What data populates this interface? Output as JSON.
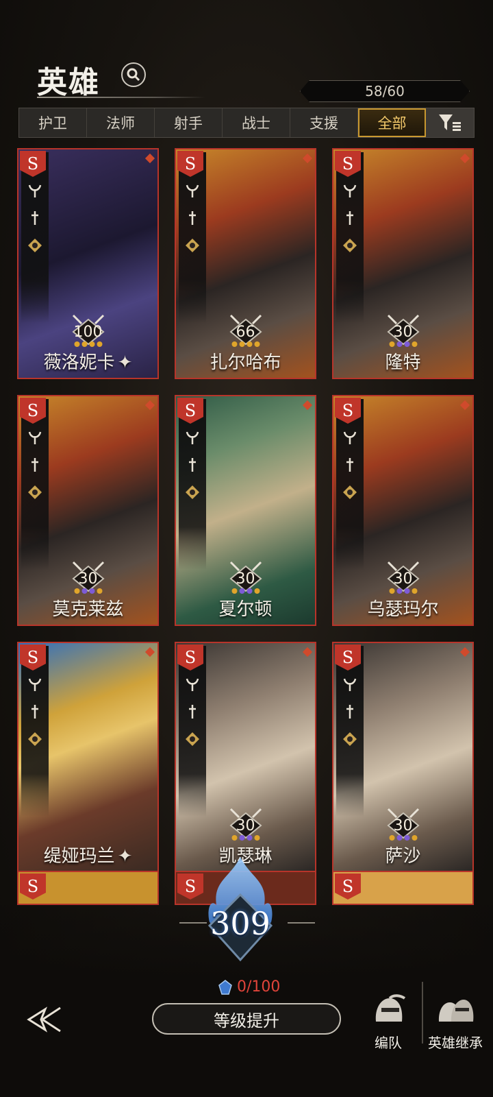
{
  "header": {
    "title": "英雄",
    "hero_count": "58/60"
  },
  "tabs": [
    {
      "label": "护卫",
      "active": false
    },
    {
      "label": "法师",
      "active": false
    },
    {
      "label": "射手",
      "active": false
    },
    {
      "label": "战士",
      "active": false
    },
    {
      "label": "支援",
      "active": false
    },
    {
      "label": "全部",
      "active": true
    }
  ],
  "heroes": [
    {
      "name": "薇洛妮卡",
      "level": "100",
      "starred": true,
      "art": "sorceress"
    },
    {
      "name": "扎尔哈布",
      "level": "66",
      "starred": false,
      "art": "knight"
    },
    {
      "name": "隆特",
      "level": "30",
      "starred": false,
      "art": "knight"
    },
    {
      "name": "莫克莱兹",
      "level": "30",
      "starred": false,
      "art": "knight"
    },
    {
      "name": "夏尔顿",
      "level": "30",
      "starred": false,
      "art": "bard"
    },
    {
      "name": "乌瑟玛尔",
      "level": "30",
      "starred": false,
      "art": "knight"
    },
    {
      "name": "缇娅玛兰",
      "level": "",
      "starred": true,
      "art": "huntress"
    },
    {
      "name": "凯瑟琳",
      "level": "30",
      "starred": false,
      "art": "priestess"
    },
    {
      "name": "萨沙",
      "level": "30",
      "starred": false,
      "art": "priestess"
    }
  ],
  "bottom": {
    "power": "309",
    "exp": "0/100",
    "upgrade_label": "等级提升",
    "team_label": "编队",
    "inherit_label": "英雄继承"
  },
  "colors": {
    "card_border": "#b8342a",
    "active_tab": "#c9982f",
    "exp_text": "#e0443a"
  }
}
